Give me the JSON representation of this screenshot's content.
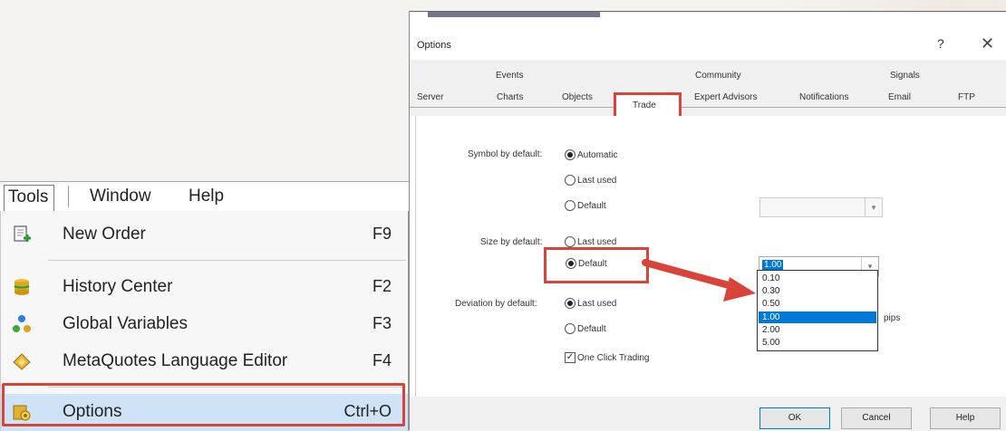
{
  "menu": {
    "bar": {
      "tools": "Tools",
      "window": "Window",
      "help": "Help"
    },
    "items": [
      {
        "label": "New Order",
        "shortcut": "F9",
        "icon": "new-order-icon"
      },
      {
        "label": "History Center",
        "shortcut": "F2",
        "icon": "history-center-icon"
      },
      {
        "label": "Global Variables",
        "shortcut": "F3",
        "icon": "global-variables-icon"
      },
      {
        "label": "MetaQuotes Language Editor",
        "shortcut": "F4",
        "icon": "language-editor-icon"
      },
      {
        "label": "Options",
        "shortcut": "Ctrl+O",
        "icon": "options-icon"
      }
    ]
  },
  "dialog": {
    "title": "Options",
    "help": "?",
    "close": "✕",
    "tabs_row1": [
      "Events",
      "Community",
      "Signals"
    ],
    "tabs_row2": [
      "Server",
      "Charts",
      "Objects",
      "Trade",
      "Expert Advisors",
      "Notifications",
      "Email",
      "FTP"
    ],
    "symbol": {
      "label": "Symbol by default:",
      "options": [
        "Automatic",
        "Last used",
        "Default"
      ],
      "selected": "Automatic"
    },
    "size": {
      "label": "Size by default:",
      "options": [
        "Last used",
        "Default"
      ],
      "selected": "Default",
      "combo_value": "1.00",
      "list": [
        "0.10",
        "0.30",
        "0.50",
        "1.00",
        "2.00",
        "5.00"
      ],
      "list_selected": "1.00"
    },
    "deviation": {
      "label": "Deviation by default:",
      "options": [
        "Last used",
        "Default"
      ],
      "selected": "Last used",
      "unit": "pips"
    },
    "one_click": {
      "label": "One Click Trading",
      "checked": true
    },
    "buttons": {
      "ok": "OK",
      "cancel": "Cancel",
      "help": "Help"
    }
  },
  "colors": {
    "highlight": "#d8443a",
    "selection": "#0078d7",
    "menu_hover": "#cfe3f6"
  }
}
